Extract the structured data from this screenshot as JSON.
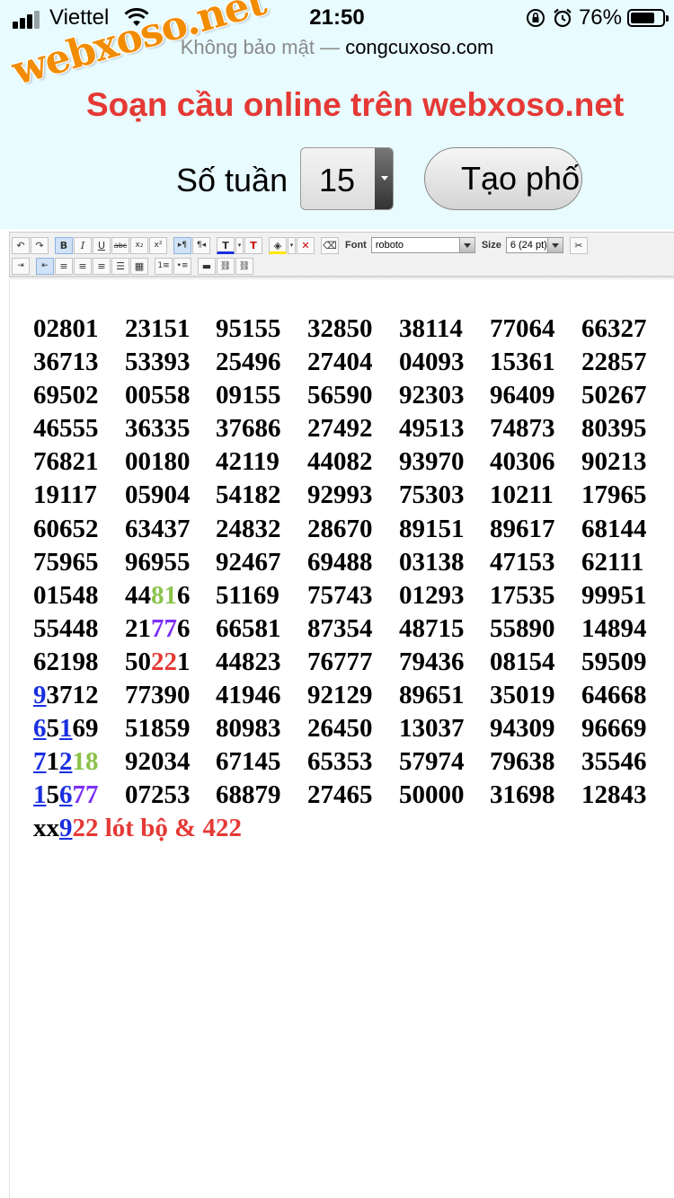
{
  "status_bar": {
    "carrier": "Viettel",
    "time": "21:50",
    "battery_percent": "76%",
    "battery_level": 0.76
  },
  "address_bar": {
    "security_text": "Không bảo mật —",
    "domain": "congcuxoso.com"
  },
  "watermark": "webxoso.net",
  "header": {
    "title": "Soạn cầu online trên webxoso.net",
    "weeks_label": "Số tuần",
    "weeks_value": "15",
    "create_button_label": "Tạo phố"
  },
  "toolbar": {
    "font_label": "Font",
    "font_value": "roboto",
    "size_label": "Size",
    "size_value": "6 (24 pt)",
    "buttons_row1": [
      "undo-icon",
      "redo-icon",
      "bold-icon",
      "italic-icon",
      "underline-icon",
      "strikethrough-icon",
      "subscript-icon",
      "superscript-icon",
      "ltr-icon",
      "rtl-icon",
      "text-color-icon",
      "clear-color-icon",
      "highlight-icon",
      "clear-highlight-icon",
      "eraser-icon",
      "cut-icon"
    ],
    "buttons_row2": [
      "indent-icon",
      "outdent-icon",
      "align-left-icon",
      "align-center-icon",
      "align-right-icon",
      "justify-icon",
      "table-icon",
      "ordered-list-icon",
      "unordered-list-icon",
      "horizontal-rule-icon",
      "link-icon",
      "unlink-icon"
    ]
  },
  "number_rows": [
    [
      "02801",
      "23151",
      "95155",
      "32850",
      "38114",
      "77064",
      "66327"
    ],
    [
      "36713",
      "53393",
      "25496",
      "27404",
      "04093",
      "15361",
      "22857"
    ],
    [
      "69502",
      "00558",
      "09155",
      "56590",
      "92303",
      "96409",
      "50267"
    ],
    [
      "46555",
      "36335",
      "37686",
      "27492",
      "49513",
      "74873",
      "80395"
    ],
    [
      "76821",
      "00180",
      "42119",
      "44082",
      "93970",
      "40306",
      "90213"
    ],
    [
      "19117",
      "05904",
      "54182",
      "92993",
      "75303",
      "10211",
      "17965"
    ],
    [
      "60652",
      "63437",
      "24832",
      "28670",
      "89151",
      "89617",
      "68144"
    ],
    [
      "75965",
      "96955",
      "92467",
      "69488",
      "03138",
      "47153",
      "62111"
    ],
    [
      "01548",
      "44816",
      "51169",
      "75743",
      "01293",
      "17535",
      "99951"
    ],
    [
      "55448",
      "21776",
      "66581",
      "87354",
      "48715",
      "55890",
      "14894"
    ],
    [
      "62198",
      "50221",
      "44823",
      "76777",
      "79436",
      "08154",
      "59509"
    ],
    [
      "93712",
      "77390",
      "41946",
      "92129",
      "89651",
      "35019",
      "64668"
    ],
    [
      "65169",
      "51859",
      "80983",
      "26450",
      "13037",
      "94309",
      "96669"
    ],
    [
      "71218",
      "92034",
      "67145",
      "65353",
      "57974",
      "79638",
      "35546"
    ],
    [
      "15677",
      "07253",
      "68879",
      "27465",
      "50000",
      "31698",
      "12843"
    ]
  ],
  "highlights": [
    {
      "row": 8,
      "col": 1,
      "spans": [
        {
          "t": "44",
          "c": ""
        },
        {
          "t": "81",
          "c": "c-green"
        },
        {
          "t": "6",
          "c": ""
        }
      ]
    },
    {
      "row": 9,
      "col": 1,
      "spans": [
        {
          "t": "21",
          "c": ""
        },
        {
          "t": "77",
          "c": "c-purple"
        },
        {
          "t": "6",
          "c": ""
        }
      ]
    },
    {
      "row": 10,
      "col": 1,
      "spans": [
        {
          "t": "50",
          "c": ""
        },
        {
          "t": "22",
          "c": "c-red"
        },
        {
          "t": "1",
          "c": ""
        }
      ]
    },
    {
      "row": 11,
      "col": 0,
      "spans": [
        {
          "t": "9",
          "c": "c-blue"
        },
        {
          "t": "3712",
          "c": ""
        }
      ]
    },
    {
      "row": 12,
      "col": 0,
      "spans": [
        {
          "t": "6",
          "c": "c-blue"
        },
        {
          "t": "5",
          "c": ""
        },
        {
          "t": "1",
          "c": "c-blue"
        },
        {
          "t": "69",
          "c": ""
        }
      ]
    },
    {
      "row": 13,
      "col": 0,
      "spans": [
        {
          "t": "7",
          "c": "c-blue"
        },
        {
          "t": "1",
          "c": ""
        },
        {
          "t": "2",
          "c": "c-blue"
        },
        {
          "t": "18",
          "c": "c-green"
        }
      ]
    },
    {
      "row": 14,
      "col": 0,
      "spans": [
        {
          "t": "1",
          "c": "c-blue"
        },
        {
          "t": "5",
          "c": ""
        },
        {
          "t": "6",
          "c": "c-blue"
        },
        {
          "t": "77",
          "c": "c-purple"
        }
      ]
    }
  ],
  "note": {
    "prefix": "xx",
    "underlined": "9",
    "rest": "22 lót bộ & 422"
  }
}
